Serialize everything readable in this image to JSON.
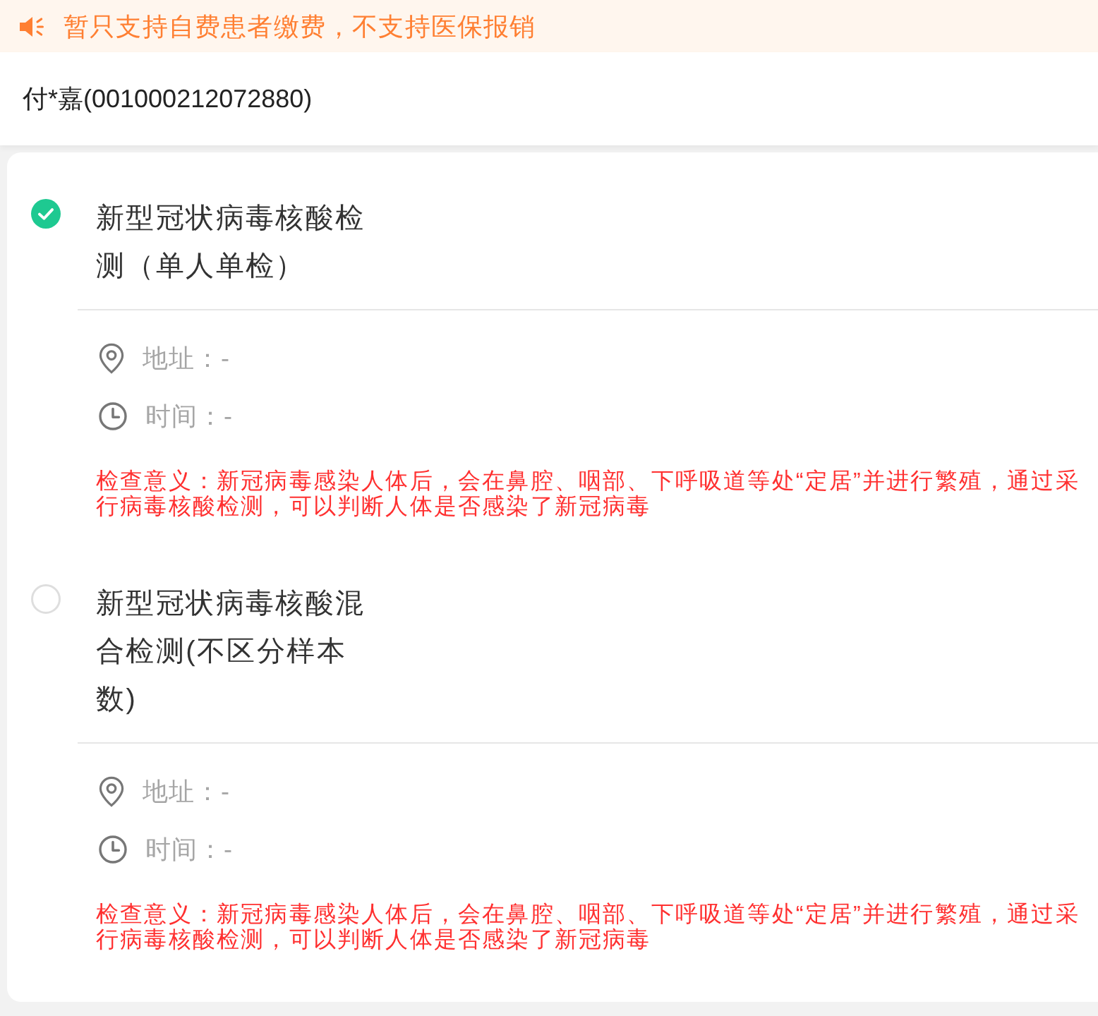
{
  "notice": {
    "text": "暂只支持自费患者缴费，不支持医保报销"
  },
  "patient": {
    "name": "付*嘉(001000212072880)"
  },
  "items": [
    {
      "title": "新型冠状病毒核酸检测（单人单检）",
      "selected": true,
      "address": "地址：-",
      "time": "时间：-",
      "description_lines": [
        "检查意义：新冠病毒感染人体后，会在鼻腔、咽部、下呼吸道等处“定居”并进行繁殖，通过采",
        "行病毒核酸检测，可以判断人体是否感染了新冠病毒"
      ]
    },
    {
      "title": "新型冠状病毒核酸混合检测(不区分样本数)",
      "selected": false,
      "address": "地址：-",
      "time": "时间：-",
      "description_lines": [
        "检查意义：新冠病毒感染人体后，会在鼻腔、咽部、下呼吸道等处“定居”并进行繁殖，通过采",
        "行病毒核酸检测，可以判断人体是否感染了新冠病毒"
      ]
    }
  ]
}
